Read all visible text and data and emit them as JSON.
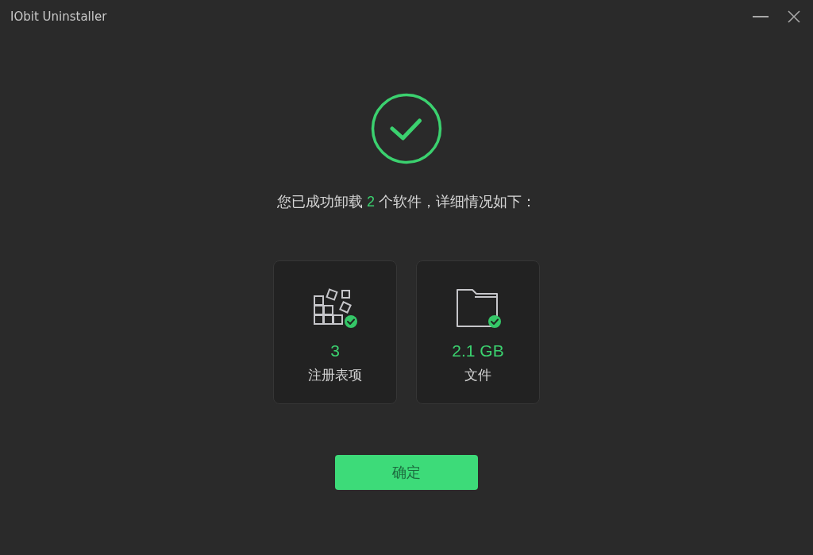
{
  "window": {
    "title": "IObit Uninstaller"
  },
  "result": {
    "message": {
      "before": "您已成功卸载 ",
      "count": "2",
      "after": " 个软件，详细情况如下："
    }
  },
  "stats": [
    {
      "kind": "registry",
      "value": "3",
      "label": "注册表项"
    },
    {
      "kind": "files",
      "value": "2.1 GB",
      "label": "文件"
    }
  ],
  "buttons": [
    {
      "label": "确定"
    }
  ]
}
